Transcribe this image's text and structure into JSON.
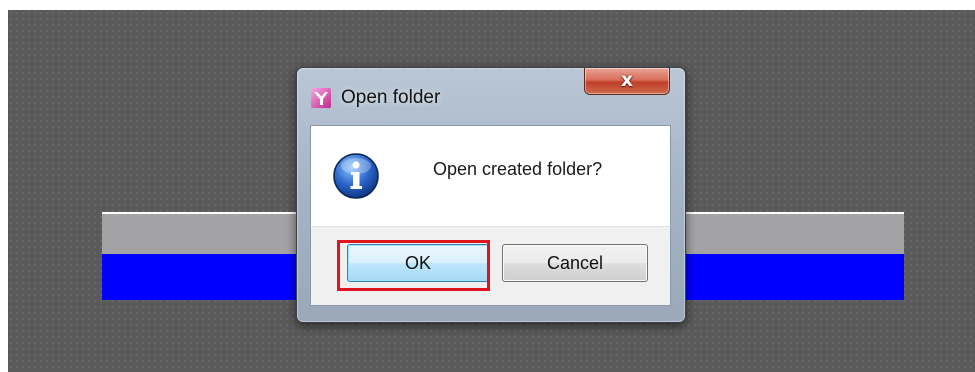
{
  "dialog": {
    "title": "Open folder",
    "close_label": "x",
    "message": "Open created folder?",
    "icon": "information-icon",
    "app_icon": "app-logo-icon",
    "buttons": {
      "ok_label": "OK",
      "cancel_label": "Cancel"
    },
    "focused_button": "OK",
    "highlight_color": "#e0141e"
  },
  "colors": {
    "background": "#5a5a5a",
    "gray_bar": "#a3a3a5",
    "blue_bar": "#0000ff"
  }
}
